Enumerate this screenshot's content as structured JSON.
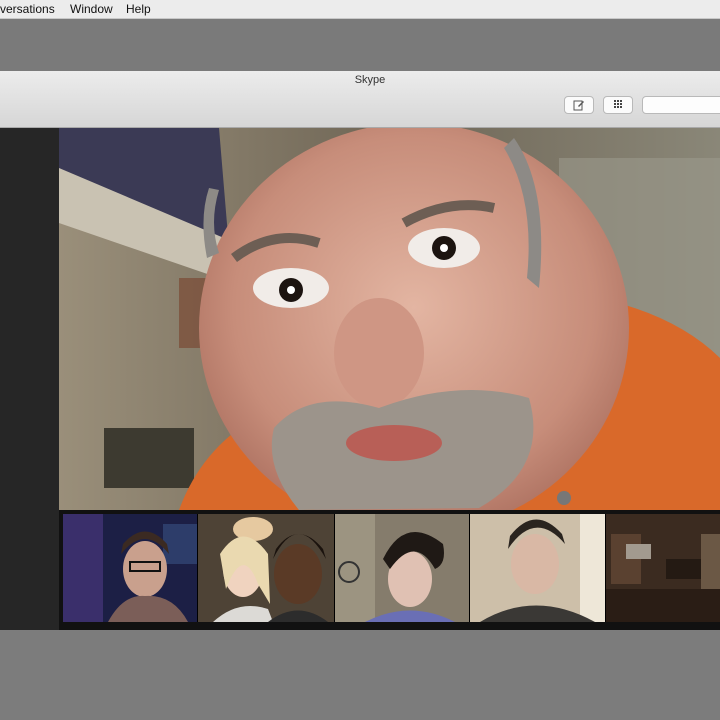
{
  "menubar": {
    "items": [
      "versations",
      "Window",
      "Help"
    ]
  },
  "window": {
    "title": "Skype"
  },
  "toolbar": {
    "compose_icon": "compose-icon",
    "dialpad_icon": "dialpad-icon",
    "search_placeholder": ""
  },
  "call": {
    "main_participant_shirt_color": "#d9692a",
    "participant_tiles": 5
  }
}
